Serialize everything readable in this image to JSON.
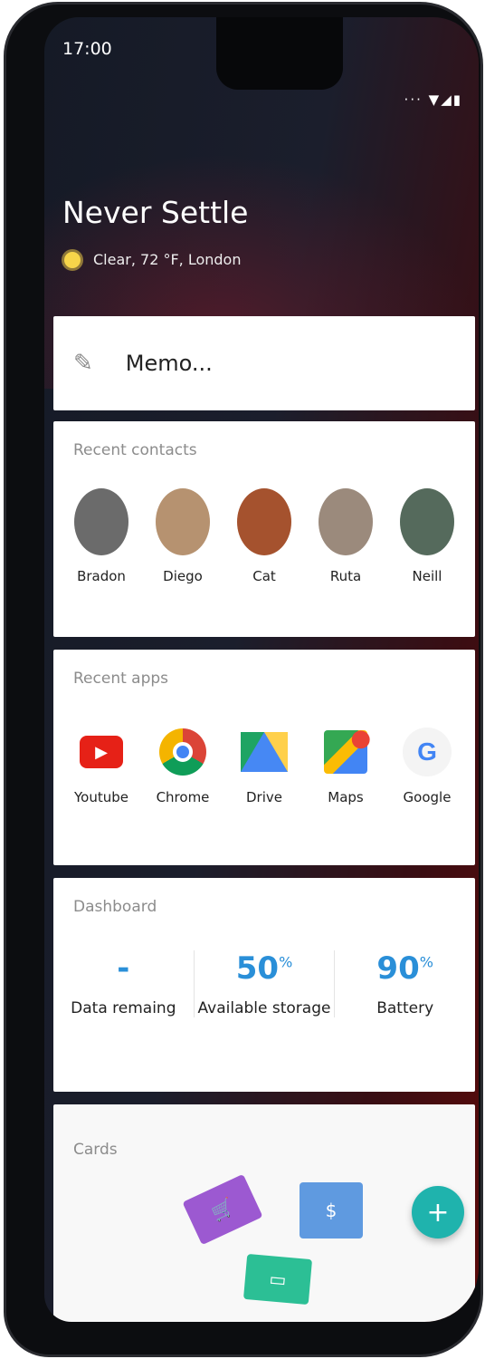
{
  "status_bar": {
    "time": "17:00",
    "icons": [
      "more-dots-icon",
      "wifi-icon",
      "signal-icon",
      "battery-icon"
    ]
  },
  "header": {
    "title": "Never Settle",
    "weather": "Clear, 72 °F, London",
    "weather_icon": "sun-icon"
  },
  "memo": {
    "placeholder": "Memo..."
  },
  "contacts": {
    "title": "Recent contacts",
    "items": [
      {
        "name": "Bradon"
      },
      {
        "name": "Diego"
      },
      {
        "name": "Cat"
      },
      {
        "name": "Ruta"
      },
      {
        "name": "Neill"
      }
    ]
  },
  "apps": {
    "title": "Recent apps",
    "items": [
      {
        "name": "Youtube",
        "color": "#e62117"
      },
      {
        "name": "Chrome",
        "color": "#4285f4"
      },
      {
        "name": "Drive",
        "color": "#1fa463"
      },
      {
        "name": "Maps",
        "color": "#34a853"
      },
      {
        "name": "Google",
        "color": "#4285f4"
      }
    ]
  },
  "dashboard": {
    "title": "Dashboard",
    "metrics": [
      {
        "value": "-",
        "unit": "",
        "label": "Data remaing"
      },
      {
        "value": "50",
        "unit": "%",
        "label": "Available storage"
      },
      {
        "value": "90",
        "unit": "%",
        "label": "Battery"
      }
    ],
    "accent": "#2a8fd8"
  },
  "cards": {
    "title": "Cards",
    "fab": "+",
    "mini": [
      {
        "icon": "cart-icon",
        "symbol": "🛒",
        "color": "#9c59d1"
      },
      {
        "icon": "dollar-icon",
        "symbol": "$",
        "color": "#5f9ae0"
      },
      {
        "icon": "bus-icon",
        "symbol": "▭",
        "color": "#2cbf95"
      }
    ]
  }
}
